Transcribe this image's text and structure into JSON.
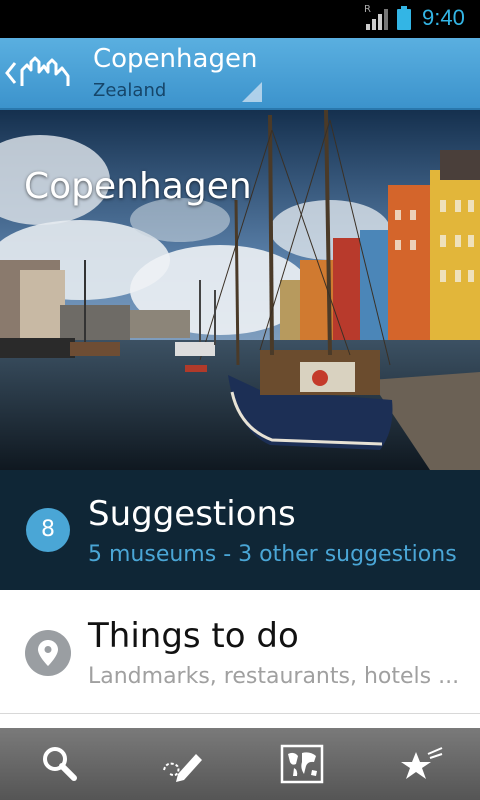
{
  "status_bar": {
    "time": "9:40",
    "roaming_indicator": "R",
    "icons": [
      "signal-icon",
      "battery-icon"
    ]
  },
  "action_bar": {
    "title": "Copenhagen",
    "subtitle": "Zealand",
    "icons": [
      "back-chevron-icon",
      "city-skyline-logo",
      "dropdown-triangle-icon"
    ]
  },
  "hero": {
    "title": "Copenhagen",
    "image": "nyhavn-harbour-photo"
  },
  "list": {
    "suggestions": {
      "badge": "8",
      "title": "Suggestions",
      "subtitle": "5 museums - 3 other suggestions"
    },
    "things_to_do": {
      "icon": "map-pin-icon",
      "title": "Things to do",
      "subtitle": "Landmarks, restaurants, hotels ..."
    }
  },
  "bottom_bar": {
    "tabs": [
      "search-icon",
      "journal-pencil-icon",
      "world-map-icon",
      "starred-icon"
    ]
  },
  "colors": {
    "action_bar": "#4aa3d9",
    "accent": "#4aa6d6",
    "status_time": "#33b5e5",
    "suggestions_bg": "#0f2636"
  }
}
